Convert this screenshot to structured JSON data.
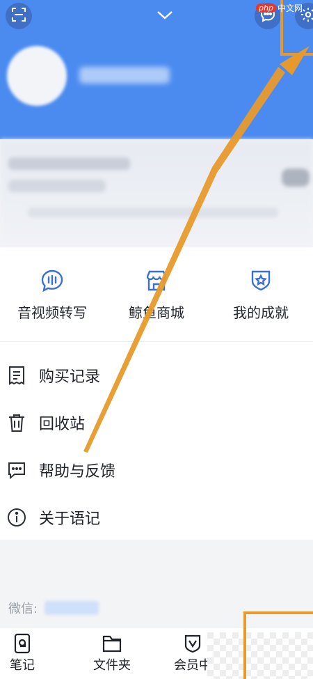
{
  "watermark": {
    "brand": "php",
    "text": "中文网"
  },
  "header": {
    "scan_icon": "scan-icon",
    "collapse_icon": "chevron-down-icon",
    "message_icon": "message-icon",
    "settings_icon": "gear-icon"
  },
  "features": [
    {
      "label": "音视频转写",
      "icon": "audio-wave-icon"
    },
    {
      "label": "鲸鱼商城",
      "icon": "store-icon"
    },
    {
      "label": "我的成就",
      "icon": "badge-icon"
    }
  ],
  "menu": [
    {
      "label": "购买记录",
      "icon": "receipt-icon"
    },
    {
      "label": "回收站",
      "icon": "trash-icon"
    },
    {
      "label": "帮助与反馈",
      "icon": "feedback-icon"
    },
    {
      "label": "关于语记",
      "icon": "info-icon"
    }
  ],
  "wechat": {
    "label": "微信:"
  },
  "tabbar": {
    "notes": "笔记",
    "folder": "文件夹",
    "member": "会员中"
  },
  "colors": {
    "header_blue": "#4b8bf0",
    "accent_blue": "#3a6fd8",
    "annotation_orange": "#e79a2b"
  }
}
